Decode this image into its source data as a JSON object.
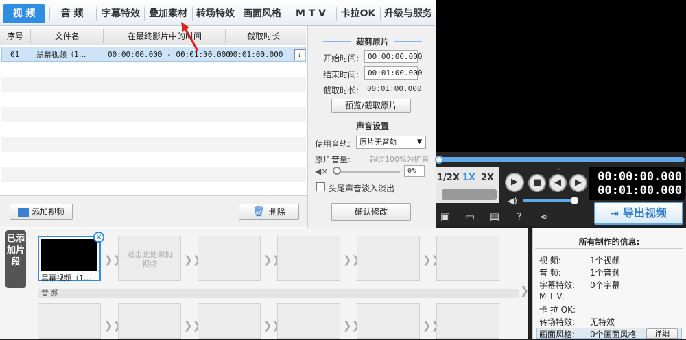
{
  "tabs": [
    {
      "label": "视  频",
      "active": true
    },
    {
      "label": "音  频"
    },
    {
      "label": "字幕特效"
    },
    {
      "label": "叠加素材"
    },
    {
      "label": "转场特效"
    },
    {
      "label": "画面风格"
    },
    {
      "label": "M T V"
    },
    {
      "label": "卡拉OK"
    },
    {
      "label": "升级与服务"
    }
  ],
  "table": {
    "headers": [
      "序号",
      "文件名",
      "在最终影片中的时间",
      "截取时长"
    ],
    "rows": [
      {
        "index": "01",
        "name": "黑幕视频（1...",
        "range": "00:00:00.000 - 00:01:00.000",
        "duration": "00:01:00.000"
      }
    ],
    "info_button": "i"
  },
  "actions": {
    "add_video": "添加视频",
    "delete": "删除"
  },
  "trim": {
    "title": "裁剪原片",
    "start_label": "开始时间:",
    "start_value": "00:00:00.000",
    "end_label": "结束时间:",
    "end_value": "00:01:00.000",
    "dur_label": "截取时长:",
    "dur_value": "00:01:00.000",
    "preview_button": "预览/截取原片"
  },
  "sound": {
    "title": "声音设置",
    "track_label": "使用音轨:",
    "track_value": "原片无音轨",
    "volume_label": "原片音量:",
    "volume_hint": "超过100%为扩音",
    "volume_value": "0%",
    "fade_label": "头尾声音淡入淡出",
    "confirm_button": "确认修改"
  },
  "player": {
    "speeds": [
      "1/2X",
      "1X",
      "2X"
    ],
    "current_time": "00:00:00.000",
    "total_time": "00:01:00.000",
    "export_button": "导出视频"
  },
  "timeline": {
    "side_label": "已添加片段",
    "first_clip": "黑幕视频（1...",
    "placeholder": "双击此处添加视频",
    "audio_label": "音 频"
  },
  "info": {
    "title": "所有制作的信息:",
    "rows": [
      {
        "k": "视    频:",
        "v": "1个视频"
      },
      {
        "k": "音    频:",
        "v": "1个音频"
      },
      {
        "k": "字幕特效:",
        "v": "0个字幕"
      },
      {
        "k": "M    T    V:",
        "v": ""
      },
      {
        "k": "卡  拉  OK:",
        "v": ""
      },
      {
        "k": "转场特效:",
        "v": "无特效"
      },
      {
        "k": "画面风格:",
        "v": "0个画面风格"
      }
    ],
    "detail_button": "详细"
  },
  "colors": {
    "accent": "#2f8de4",
    "selection": "#cde3f7",
    "player_bg": "#262626"
  }
}
